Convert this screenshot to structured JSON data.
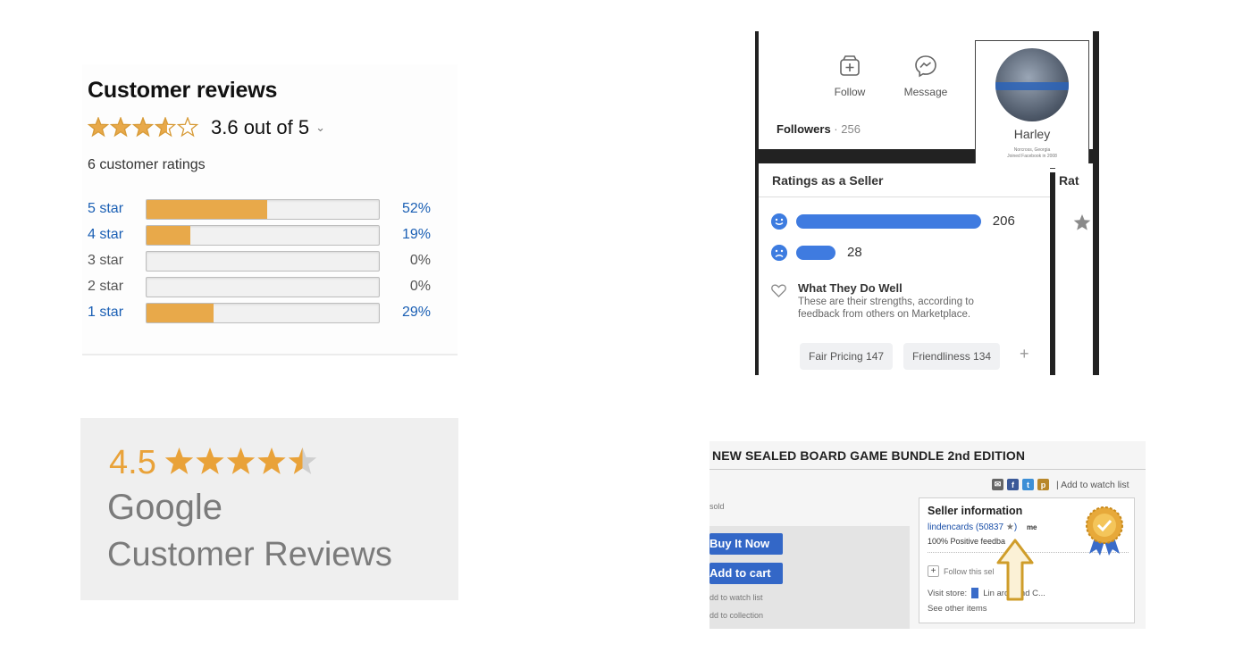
{
  "amazon": {
    "title": "Customer reviews",
    "rating_value": 3.6,
    "rating_text": "3.6 out of 5",
    "chevron": "⌄",
    "ratings_count": "6 customer ratings",
    "star_color": "#e8a94a",
    "bars": [
      {
        "label": "5 star",
        "percent": 52,
        "percent_text": "52%",
        "link": true
      },
      {
        "label": "4 star",
        "percent": 19,
        "percent_text": "19%",
        "link": true
      },
      {
        "label": "3 star",
        "percent": 0,
        "percent_text": "0%",
        "link": false
      },
      {
        "label": "2 star",
        "percent": 0,
        "percent_text": "0%",
        "link": false
      },
      {
        "label": "1 star",
        "percent": 29,
        "percent_text": "29%",
        "link": true
      }
    ]
  },
  "facebook": {
    "follow_label": "Follow",
    "message_label": "Message",
    "followers_label": "Followers",
    "followers_sep": " · ",
    "followers_count": "256",
    "profile": {
      "name": "Harley",
      "location": "Norcross, Georgia",
      "joined": "Joined Facebook in 2008"
    },
    "ratings_title": "Ratings as a Seller",
    "ratings_title_cut": "Rat",
    "positive_count": "206",
    "positive_fraction": 0.88,
    "negative_count": "28",
    "negative_fraction": 0.12,
    "bar_color": "#3f7be0",
    "what_title": "What They Do Well",
    "what_desc": "These are their strengths, according to feedback from others on Marketplace.",
    "chips": [
      "Fair Pricing 147",
      "Friendliness 134"
    ],
    "plus": "+"
  },
  "google": {
    "score": "4.5",
    "stars": 4.5,
    "line1": "Google",
    "line2": "Customer Reviews",
    "star_color": "#e9a239"
  },
  "ebay": {
    "title": "NEW SEALED BOARD GAME BUNDLE 2nd EDITION",
    "watch_list": "Add to watch list",
    "sold_text": "sold",
    "buy_now": "Buy It Now",
    "add_to_cart": "Add to cart",
    "add_watch": "dd to watch list",
    "add_collection": "dd to collection",
    "seller_heading": "Seller information",
    "seller_name": "lindencards (50837",
    "seller_name_tail": ")",
    "me_badge": "me",
    "positive_feedback": "100% Positive feedba",
    "follow_seller": "Follow this sel",
    "visit_store_label": "Visit store:",
    "store_name": "Lin      ards and C...",
    "other_items": "See other items"
  }
}
